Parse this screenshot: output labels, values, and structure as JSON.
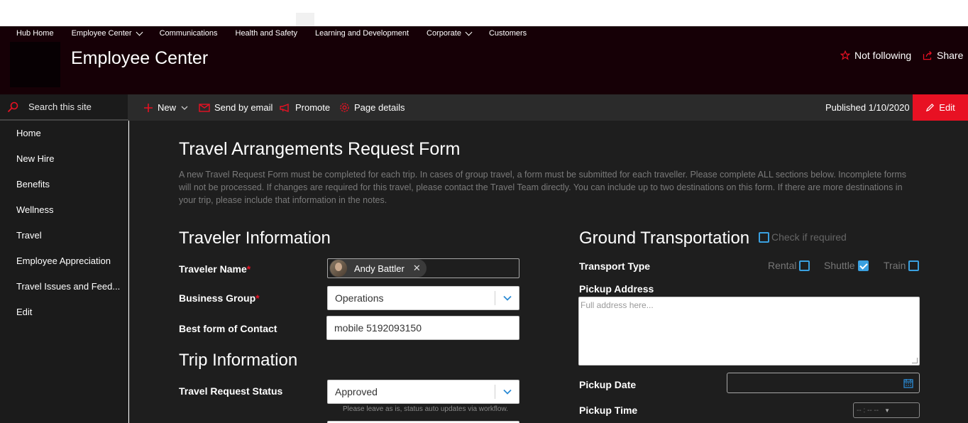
{
  "hub_nav": {
    "items": [
      {
        "label": "Hub Home",
        "has_dropdown": false
      },
      {
        "label": "Employee Center",
        "has_dropdown": true
      },
      {
        "label": "Communications",
        "has_dropdown": false
      },
      {
        "label": "Health and Safety",
        "has_dropdown": false
      },
      {
        "label": "Learning and Development",
        "has_dropdown": false
      },
      {
        "label": "Corporate",
        "has_dropdown": true
      },
      {
        "label": "Customers",
        "has_dropdown": false
      }
    ]
  },
  "site": {
    "title": "Employee Center",
    "follow_label": "Not following",
    "share_label": "Share"
  },
  "left_nav": {
    "search_placeholder": "Search this site",
    "items": [
      "Home",
      "New Hire",
      "Benefits",
      "Wellness",
      "Travel",
      "Employee Appreciation",
      "Travel Issues and Feed...",
      "Edit"
    ]
  },
  "command_bar": {
    "new_label": "New",
    "email_label": "Send by email",
    "promote_label": "Promote",
    "details_label": "Page details",
    "published": "Published 1/10/2020",
    "edit_label": "Edit"
  },
  "form": {
    "title": "Travel Arrangements Request Form",
    "intro": "A new Travel Request Form must be completed for each trip. In cases of group travel, a form must be submitted for each traveller. Please complete ALL sections below. Incomplete forms will not be processed. If changes are required for this travel, please contact the Travel Team directly. You can include up to two destinations on this form. If there are more destinations in your trip, please include that information in the notes.",
    "traveler_section": "Traveler Information",
    "traveler_name_label": "Traveler Name",
    "traveler_name_value": "Andy Battler",
    "business_group_label": "Business Group",
    "business_group_value": "Operations",
    "contact_label": "Best form of Contact",
    "contact_value": "mobile 5192093150",
    "trip_section": "Trip Information",
    "status_label": "Travel Request Status",
    "status_value": "Approved",
    "status_hint": "Please leave as is, status auto updates via workflow.",
    "required_marker": "*"
  },
  "ground": {
    "section": "Ground Transportation",
    "check_label": "Check if required",
    "check_required": false,
    "transport_label": "Transport Type",
    "options": [
      {
        "label": "Rental",
        "checked": false
      },
      {
        "label": "Shuttle",
        "checked": true
      },
      {
        "label": "Train",
        "checked": false
      }
    ],
    "pickup_address_label": "Pickup Address",
    "pickup_address_placeholder": "Full address here...",
    "pickup_date_label": "Pickup Date",
    "pickup_time_label": "Pickup Time",
    "pickup_time_placeholder": "-- : --   --"
  },
  "colors": {
    "accent_red": "#e81123",
    "header_bg": "#160006",
    "checkbox_blue": "#3aa0e0"
  }
}
